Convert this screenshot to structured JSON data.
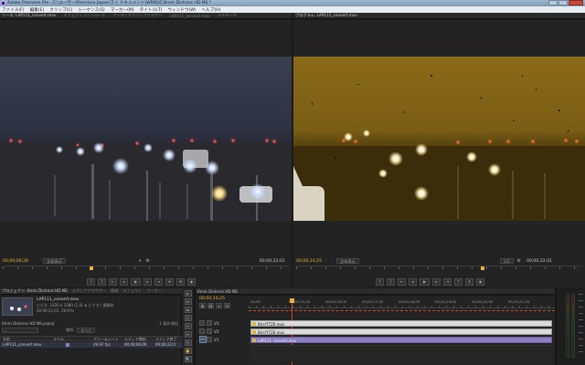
{
  "window": {
    "title": "Adobe Premiere Pro - C:\\ユーザー\\Premiere Japan\\マイ ドキュメント\\WRROC\\6mm Distress HD NS *"
  },
  "menubar": {
    "items": [
      "ファイル(F)",
      "編集(E)",
      "クリップ(C)",
      "シーケンス(S)",
      "マーカー(M)",
      "タイトル(T)",
      "ウィンドウ(W)",
      "ヘルプ(H)"
    ]
  },
  "source_monitor": {
    "tabs": [
      "ソース: LAP111_convert.mov",
      "エフェクトコントロール",
      "オーディオクリップミキサー",
      "LAP111_convert.mov",
      "メタデータ"
    ],
    "timecode_in": "00;00;06;26",
    "fit_label": "全体表示",
    "timecode_out": "00;00;22;01"
  },
  "program_monitor": {
    "tabs": [
      "プログラム: LAP111_convert.mov"
    ],
    "timecode_in": "00;00;14;25",
    "fit_label": "全体表示",
    "timecode_out": "00;00;22;01",
    "quality": "1/2"
  },
  "project_panel": {
    "tabs": [
      "プロジェクト: 6mm Distress HD NS",
      "メディアブラウザー",
      "情報",
      "エフェクト",
      "マーカー"
    ],
    "clip_name": "LAP111_convert.mov",
    "clip_info1": "ビデオ, 1920 x 1080 (1.0) ★ ビデオ / 黄緑系",
    "clip_info2": "00;00;22;01, 29.97p",
    "project_file": "6mm Distress HD NS.prproj",
    "item_count": "1 個の項目",
    "search_label": "場所:",
    "search_value": "すべて",
    "columns": [
      "名前",
      "ラベル",
      "フレームレート",
      "メディア開始",
      "メディア終了"
    ],
    "row": {
      "name": "LAP111_convert.mov",
      "fps": "29.97 fps",
      "start": "00;00;00;00",
      "end": "00;00;22;0"
    }
  },
  "timeline": {
    "tab": "6mm Distress HD NS",
    "timecode": "00;00;14;25",
    "ruler_labels": [
      "00;00",
      "00;00;15;00",
      "00;00;16;00",
      "00;00;17;00",
      "00;00;18;00",
      "00;00;19;00",
      "00;00;20;00",
      "00;00;21;00"
    ],
    "tracks": [
      "V3",
      "V2",
      "V1"
    ],
    "clips": [
      {
        "label": "Blrs[YTZ8.mov"
      },
      {
        "label": "Blrs[YTZ8.mov"
      },
      {
        "label": "LAP111_convert.mov"
      }
    ]
  },
  "tools": [
    "▸",
    "⇔",
    "⇆",
    "◇",
    "✂",
    "↔",
    "✎",
    "✋",
    "🔍"
  ],
  "colors": {
    "accent_timecode": "#e8b23c",
    "playhead": "#d33b2e",
    "clip_purple": "#8d7fc0"
  }
}
